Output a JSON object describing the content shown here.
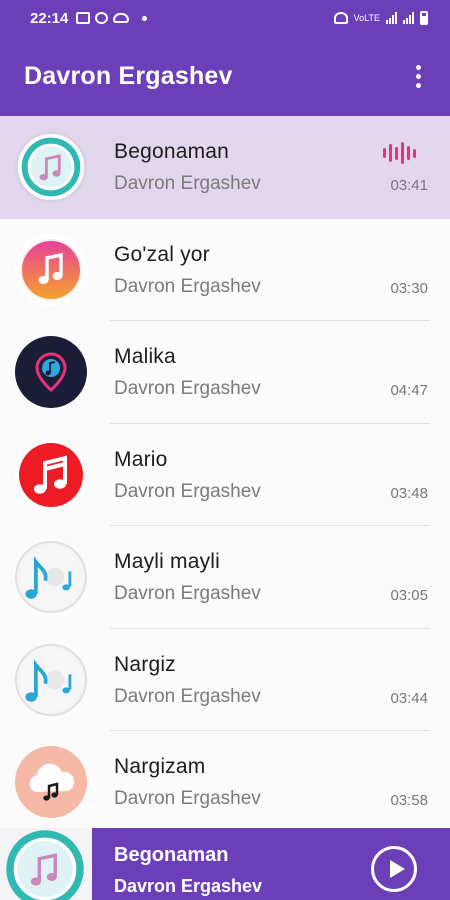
{
  "status_bar": {
    "time": "22:14",
    "network": "VoLTE"
  },
  "app_bar": {
    "title": "Davron Ergashev"
  },
  "songs": [
    {
      "title": "Begonaman",
      "artist": "Davron Ergashev",
      "duration": "03:41",
      "playing": true,
      "cover_icon": "music-note-teal-circle-icon"
    },
    {
      "title": "Go'zal yor",
      "artist": "Davron Ergashev",
      "duration": "03:30",
      "cover_icon": "music-note-orange-gradient-icon"
    },
    {
      "title": "Malika",
      "artist": "Davron Ergashev",
      "duration": "04:47",
      "cover_icon": "music-note-pin-dark-icon"
    },
    {
      "title": "Mario",
      "artist": "Davron Ergashev",
      "duration": "03:48",
      "cover_icon": "music-note-red-icon"
    },
    {
      "title": "Mayli mayli",
      "artist": "Davron Ergashev",
      "duration": "03:05",
      "cover_icon": "music-notes-cyan-icon"
    },
    {
      "title": "Nargiz",
      "artist": "Davron Ergashev",
      "duration": "03:44",
      "cover_icon": "music-notes-cyan-icon"
    },
    {
      "title": "Nargizam",
      "artist": "Davron Ergashev",
      "duration": "03:58",
      "cover_icon": "cloud-music-note-icon"
    }
  ],
  "player": {
    "title": "Begonaman",
    "artist": "Davron Ergashev",
    "play_icon": "play-icon"
  },
  "colors": {
    "primary": "#6a3fb8",
    "active_row": "#e3d7ee",
    "equalizer": "#e8327e"
  }
}
